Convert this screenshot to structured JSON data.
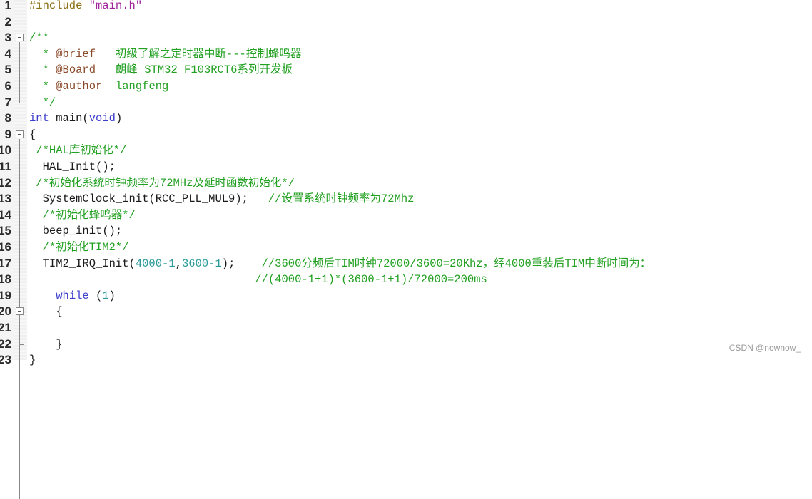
{
  "editor": {
    "lines": [
      {
        "n": "1",
        "segs": [
          {
            "c": "pp",
            "t": "#include "
          },
          {
            "c": "str",
            "t": "\"main.h\""
          }
        ]
      },
      {
        "n": "2",
        "segs": []
      },
      {
        "n": "3",
        "segs": [
          {
            "c": "cm",
            "t": "/**"
          }
        ]
      },
      {
        "n": "4",
        "segs": [
          {
            "c": "cm",
            "t": "  * "
          },
          {
            "c": "doc",
            "t": "@brief"
          },
          {
            "c": "cm",
            "t": "   初级了解之定时器中断---控制蜂鸣器"
          }
        ]
      },
      {
        "n": "5",
        "segs": [
          {
            "c": "cm",
            "t": "  * "
          },
          {
            "c": "doc",
            "t": "@Board"
          },
          {
            "c": "cm",
            "t": "   朗峰 STM32 F103RCT6系列开发板"
          }
        ]
      },
      {
        "n": "6",
        "segs": [
          {
            "c": "cm",
            "t": "  * "
          },
          {
            "c": "doc",
            "t": "@author"
          },
          {
            "c": "cm",
            "t": "  langfeng"
          }
        ]
      },
      {
        "n": "7",
        "segs": [
          {
            "c": "cm",
            "t": "  */"
          }
        ]
      },
      {
        "n": "8",
        "segs": [
          {
            "c": "kw",
            "t": "int"
          },
          {
            "c": "",
            "t": " main("
          },
          {
            "c": "kw",
            "t": "void"
          },
          {
            "c": "",
            "t": ")"
          }
        ]
      },
      {
        "n": "9",
        "segs": [
          {
            "c": "",
            "t": "{"
          }
        ]
      },
      {
        "n": "10",
        "segs": [
          {
            "c": "cm",
            "t": " /*HAL库初始化*/"
          }
        ]
      },
      {
        "n": "11",
        "segs": [
          {
            "c": "",
            "t": "  HAL_Init();"
          }
        ]
      },
      {
        "n": "12",
        "segs": [
          {
            "c": "cm",
            "t": " /*初始化系统时钟频率为72MHz及延时函数初始化*/"
          }
        ]
      },
      {
        "n": "13",
        "segs": [
          {
            "c": "",
            "t": "  SystemClock_init(RCC_PLL_MUL9);   "
          },
          {
            "c": "cm",
            "t": "//设置系统时钟频率为72Mhz"
          }
        ]
      },
      {
        "n": "14",
        "segs": [
          {
            "c": "cm",
            "t": "  /*初始化蜂鸣器*/"
          }
        ]
      },
      {
        "n": "15",
        "segs": [
          {
            "c": "",
            "t": "  beep_init();"
          }
        ]
      },
      {
        "n": "16",
        "segs": [
          {
            "c": "cm",
            "t": "  /*初始化TIM2*/"
          }
        ]
      },
      {
        "n": "17",
        "segs": [
          {
            "c": "",
            "t": "  TIM2_IRQ_Init("
          },
          {
            "c": "num",
            "t": "4000-1"
          },
          {
            "c": "",
            "t": ","
          },
          {
            "c": "num",
            "t": "3600-1"
          },
          {
            "c": "",
            "t": ");    "
          },
          {
            "c": "cm",
            "t": "//3600分频后TIM时钟72000/3600=20Khz，经4000重装后TIM中断时间为："
          }
        ]
      },
      {
        "n": "18",
        "segs": [
          {
            "c": "",
            "t": "                                  "
          },
          {
            "c": "cm",
            "t": "//(4000-1+1)*(3600-1+1)/72000=200ms"
          }
        ]
      },
      {
        "n": "19",
        "segs": [
          {
            "c": "",
            "t": "    "
          },
          {
            "c": "kw",
            "t": "while"
          },
          {
            "c": "",
            "t": " ("
          },
          {
            "c": "num",
            "t": "1"
          },
          {
            "c": "",
            "t": ")"
          }
        ]
      },
      {
        "n": "20",
        "segs": [
          {
            "c": "",
            "t": "    {"
          }
        ]
      },
      {
        "n": "21",
        "segs": []
      },
      {
        "n": "22",
        "segs": [
          {
            "c": "",
            "t": "    }"
          }
        ]
      },
      {
        "n": "23",
        "segs": [
          {
            "c": "",
            "t": "}"
          }
        ]
      }
    ],
    "folds": [
      3,
      9,
      20
    ]
  },
  "watermark": "CSDN @nownow_"
}
